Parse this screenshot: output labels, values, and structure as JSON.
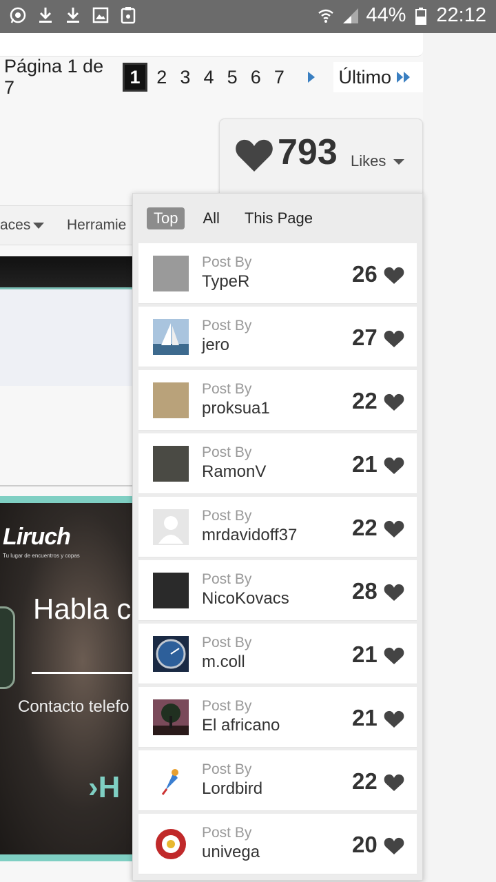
{
  "status_bar": {
    "battery": "44%",
    "time": "22:12",
    "left_icons": [
      "whatsapp-icon",
      "download-icon",
      "download-icon",
      "image-icon",
      "clipboard-icon"
    ],
    "right_icons": [
      "wifi-icon",
      "signal-icon",
      "battery-icon"
    ]
  },
  "pagination": {
    "label": "Página 1 de 7",
    "pages": [
      "1",
      "2",
      "3",
      "4",
      "5",
      "6",
      "7"
    ],
    "active_page": "1",
    "last_label": "Último"
  },
  "background": {
    "nav_item_1": "aces",
    "nav_item_2": "Herramie",
    "ad_logo": "Liruch",
    "ad_sub": "Tu lugar de encuentros y copas",
    "ad_title": "Habla c",
    "ad_contact": "Contacto telefo",
    "ad_cta": "H"
  },
  "likes": {
    "count": "793",
    "label": "Likes"
  },
  "tabs": [
    "Top",
    "All",
    "This Page"
  ],
  "active_tab": "Top",
  "post_by_label": "Post By",
  "posts": [
    {
      "author": "TypeR",
      "likes": "26",
      "avatar_color": "#9a9a9a"
    },
    {
      "author": "jero",
      "likes": "27",
      "avatar_color": "#8aa6c2"
    },
    {
      "author": "proksua1",
      "likes": "22",
      "avatar_color": "#b9a27a"
    },
    {
      "author": "RamonV",
      "likes": "21",
      "avatar_color": "#4a4a44"
    },
    {
      "author": "mrdavidoff37",
      "likes": "22",
      "avatar_color": "#e0e0e0"
    },
    {
      "author": "NicoKovacs",
      "likes": "28",
      "avatar_color": "#2a2a2a"
    },
    {
      "author": "m.coll",
      "likes": "21",
      "avatar_color": "#2d5f9a"
    },
    {
      "author": "El africano",
      "likes": "21",
      "avatar_color": "#6b3a3a"
    },
    {
      "author": "Lordbird",
      "likes": "22",
      "avatar_color": "#ffffff"
    },
    {
      "author": "univega",
      "likes": "20",
      "avatar_color": "#ffffff"
    }
  ],
  "colors": {
    "status_bar": "#6b6b6b",
    "heart": "#444444",
    "accent_teal": "#7fcfc3",
    "pagination_arrow": "#3a7fc1"
  }
}
